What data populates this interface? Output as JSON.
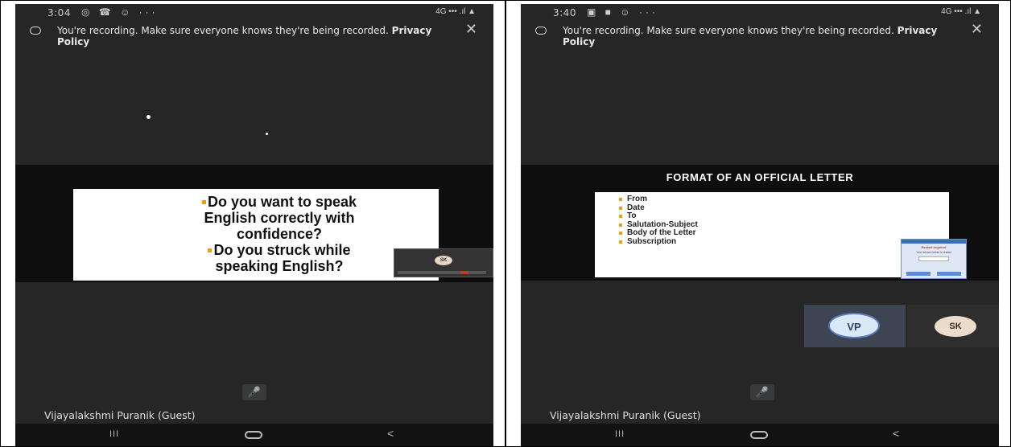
{
  "left": {
    "status": {
      "time": "3:04",
      "icons": "◎ ☎ ☺ ···",
      "right": "4G ••• .ıl ▲"
    },
    "banner": {
      "text": "You're recording. Make sure everyone knows they're being recorded.",
      "link": "Privacy Policy",
      "close": "✕"
    },
    "slide": {
      "items": [
        {
          "line1": "Do you want to speak",
          "line2": "English correctly with",
          "line3": "confidence?"
        },
        {
          "line1": "Do you struck while",
          "line2": "speaking English?"
        }
      ],
      "pip_avatar": "SK"
    },
    "mic_icon": "🎤",
    "participant_name": "Vijayalakshmi Puranik (Guest)",
    "nav": {
      "recents": "III",
      "back": "<"
    }
  },
  "right": {
    "status": {
      "time": "3:40",
      "icons": "▣ ■ ☺ ···",
      "right": "4G ••• .ıl ▲"
    },
    "banner": {
      "text": "You're recording. Make sure everyone knows they're being recorded.",
      "link": "Privacy Policy",
      "close": "✕"
    },
    "slide": {
      "title": "FORMAT OF AN OFFICIAL LETTER",
      "items": [
        "From",
        "Date",
        "To",
        "Salutation-Subject",
        "Body of the Letter",
        "Subscription"
      ],
      "popup_title": "Restart required",
      "popup_line": "Your device needs to restart"
    },
    "tiles": [
      {
        "initials": "VP"
      },
      {
        "initials": "SK"
      }
    ],
    "mic_icon": "🎤",
    "participant_name": "Vijayalakshmi Puranik (Guest)",
    "nav": {
      "recents": "III",
      "back": "<"
    }
  },
  "colors": {
    "phone_bg": "#262626",
    "bullet": "#f39c12",
    "banner_text": "#e8e8e8"
  }
}
